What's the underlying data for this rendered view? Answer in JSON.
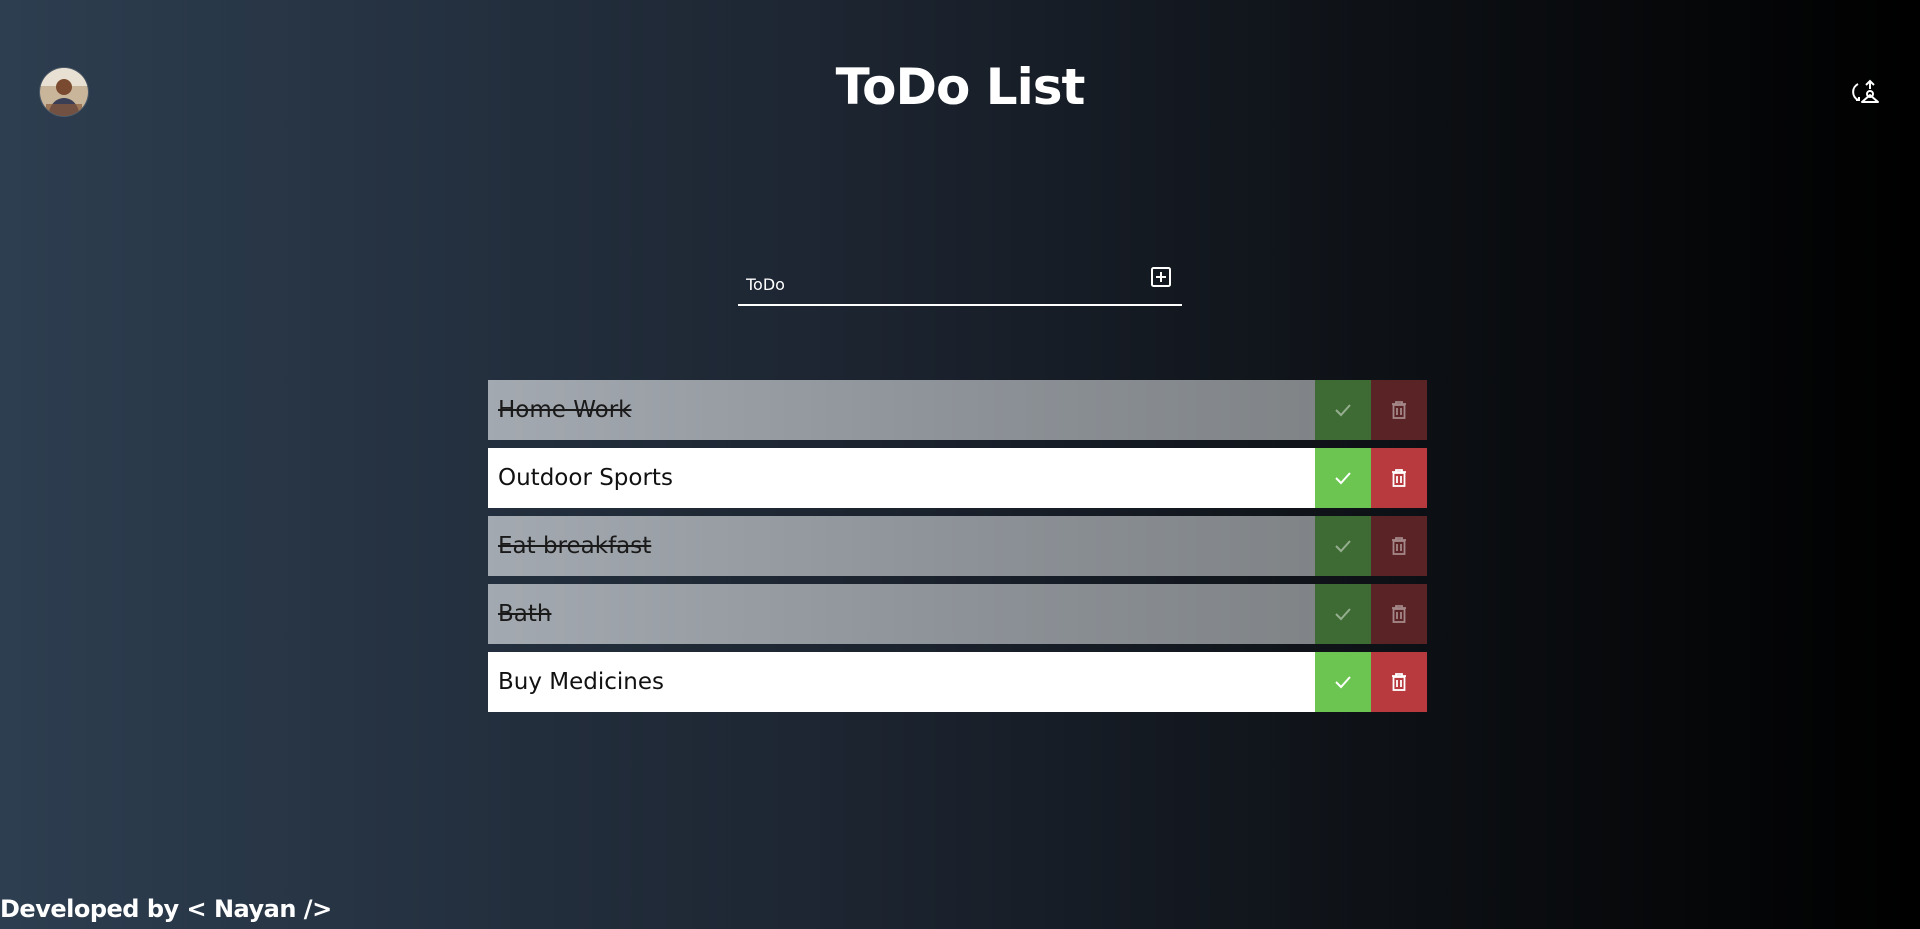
{
  "header": {
    "title": "ToDo List",
    "avatar_icon": "user-avatar",
    "theme_toggle_icon": "theme-toggle-icon"
  },
  "input": {
    "placeholder": "ToDo",
    "value": "",
    "add_icon": "plus-square-icon"
  },
  "todos": [
    {
      "text": "Home Work",
      "completed": true
    },
    {
      "text": "Outdoor Sports",
      "completed": false
    },
    {
      "text": "Eat breakfast",
      "completed": true
    },
    {
      "text": "Bath",
      "completed": true
    },
    {
      "text": "Buy Medicines",
      "completed": false
    }
  ],
  "footer": {
    "text": "Developed by < Nayan />"
  },
  "colors": {
    "check": "#6cc551",
    "delete": "#b83a3e",
    "done_check": "#3e6b33",
    "done_delete": "#5a2427"
  }
}
